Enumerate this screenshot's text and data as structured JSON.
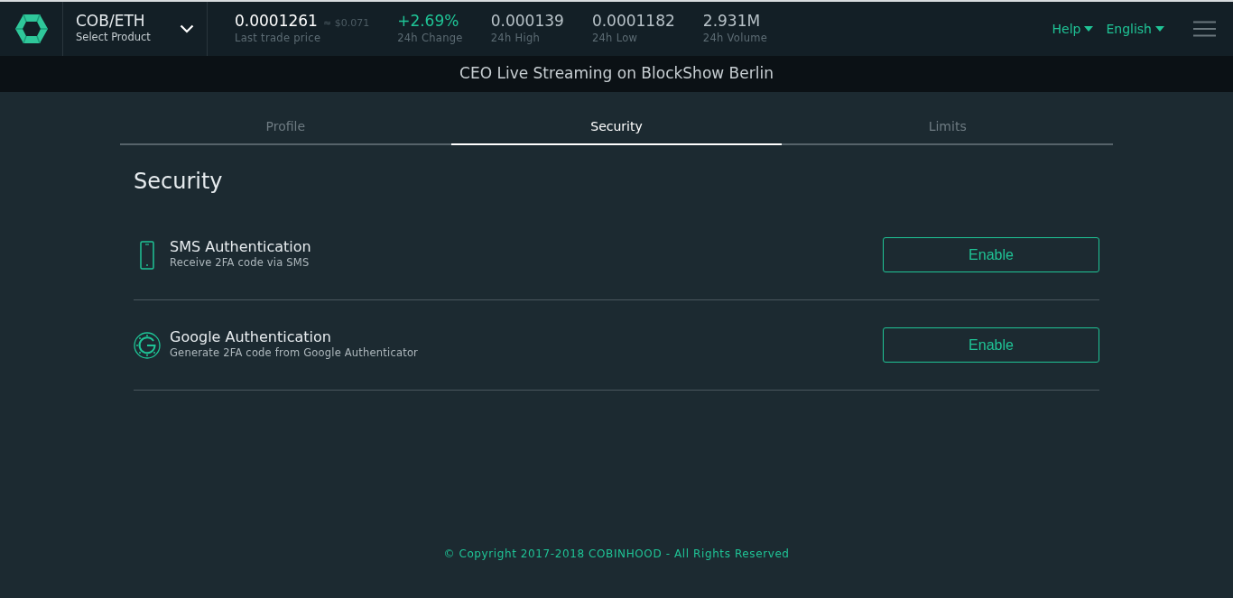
{
  "header": {
    "product": {
      "pair": "COB/ETH",
      "label": "Select Product"
    },
    "stats": [
      {
        "kind": "price",
        "value": "0.0001261",
        "approx": "≈ $0.071",
        "label": "Last trade price"
      },
      {
        "kind": "change",
        "value": "+2.69%",
        "label": "24h Change"
      },
      {
        "kind": "plain",
        "value": "0.000139",
        "label": "24h High"
      },
      {
        "kind": "plain",
        "value": "0.0001182",
        "label": "24h Low"
      },
      {
        "kind": "plain",
        "value": "2.931M",
        "label": "24h Volume"
      }
    ],
    "menus": [
      "Help",
      "English"
    ]
  },
  "banner": "CEO Live Streaming on BlockShow Berlin",
  "tabs": [
    {
      "label": "Profile",
      "selected": false
    },
    {
      "label": "Security",
      "selected": true
    },
    {
      "label": "Limits",
      "selected": false
    }
  ],
  "section_title": "Security",
  "methods": [
    {
      "kind": "phone",
      "title": "SMS Authentication",
      "description": "Receive 2FA code via SMS",
      "button": "Enable"
    },
    {
      "kind": "authenticator",
      "title": "Google Authentication",
      "description": "Generate 2FA code from Google Authenticator",
      "button": "Enable"
    }
  ],
  "footer": "© Copyright 2017-2018 COBINHOOD - All Rights Reserved"
}
